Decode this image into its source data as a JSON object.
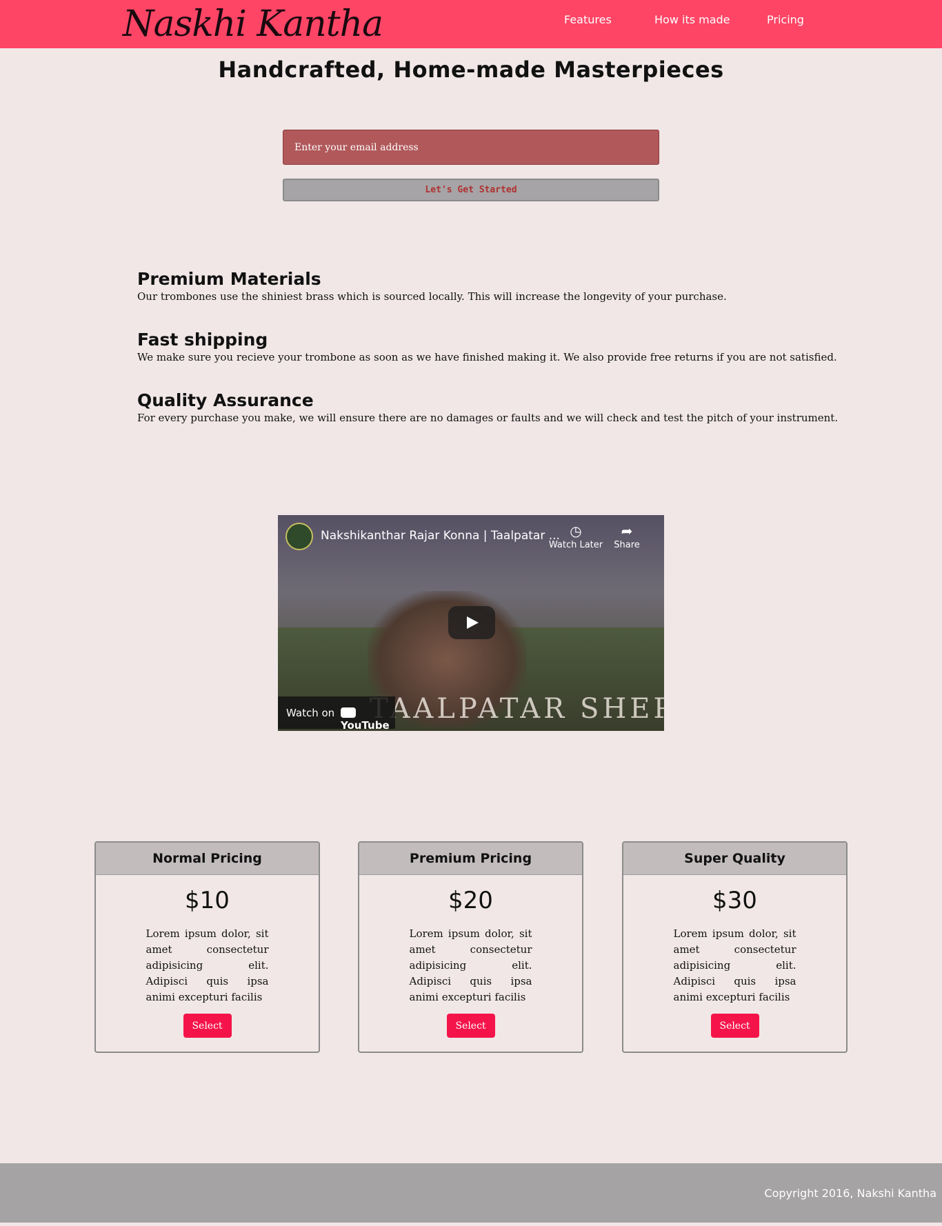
{
  "header": {
    "logo": "Naskhi Kantha",
    "nav": [
      "Features",
      "How its made",
      "Pricing"
    ]
  },
  "hero": {
    "title": "Handcrafted, Home-made Masterpieces",
    "email_placeholder": "Enter your email address",
    "cta_label": "Let's Get Started"
  },
  "features": [
    {
      "title": "Premium Materials",
      "text": "Our trombones use the shiniest brass which is sourced locally. This will increase the longevity of your purchase."
    },
    {
      "title": "Fast shipping",
      "text": "We make sure you recieve your trombone as soon as we have finished making it. We also provide free returns if you are not satisfied."
    },
    {
      "title": "Quality Assurance",
      "text": "For every purchase you make, we will ensure there are no damages or faults and we will check and test the pitch of your instrument."
    }
  ],
  "video": {
    "title": "Nakshikanthar Rajar Konna | Taalpatar ...",
    "watch_later": "Watch Later",
    "share": "Share",
    "watch_on": "Watch on",
    "youtube": "YouTube",
    "overlay_text": "TAALPATAR SHEPAI",
    "icons": {
      "watch_later": "clock-icon",
      "share": "share-icon",
      "play": "play-icon"
    }
  },
  "pricing": [
    {
      "name": "Normal Pricing",
      "price": "$10",
      "desc": "Lorem ipsum dolor, sit amet consectetur adipisicing elit. Adipisci quis ipsa animi excepturi facilis",
      "button": "Select"
    },
    {
      "name": "Premium Pricing",
      "price": "$20",
      "desc": "Lorem ipsum dolor, sit amet consectetur adipisicing elit. Adipisci quis ipsa animi excepturi facilis",
      "button": "Select"
    },
    {
      "name": "Super Quality",
      "price": "$30",
      "desc": "Lorem ipsum dolor, sit amet consectetur adipisicing elit. Adipisci quis ipsa animi excepturi facilis",
      "button": "Select"
    }
  ],
  "footer": {
    "copyright": "Copyright 2016, Nakshi Kantha"
  },
  "colors": {
    "header_bg": "#ff4566",
    "page_bg": "#f1e7e7",
    "select_button": "#f5144a",
    "footer_bg": "#a5a3a4",
    "email_field": "#b0585a"
  }
}
